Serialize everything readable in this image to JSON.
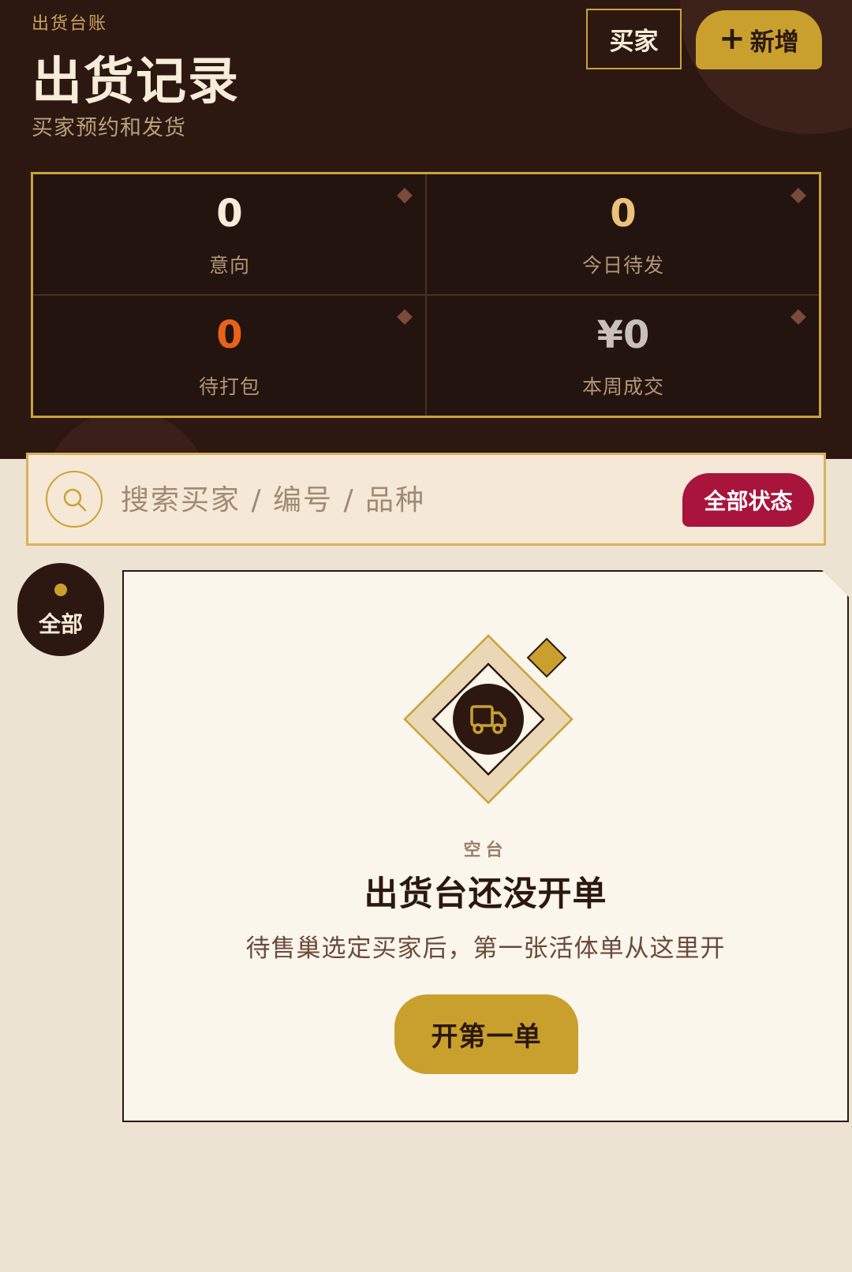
{
  "header": {
    "eyebrow": "出货台账",
    "title": "出货记录",
    "subtitle": "买家预约和发货",
    "buyer_button": "买家",
    "add_button": "新增",
    "add_icon": "plus-icon"
  },
  "stats": [
    {
      "value": "0",
      "label": "意向",
      "color": "#f7ecd8"
    },
    {
      "value": "0",
      "label": "今日待发",
      "color": "#ecc279"
    },
    {
      "value": "0",
      "label": "待打包",
      "color": "#e8621a"
    },
    {
      "value": "¥0",
      "label": "本周成交",
      "color": "#c9c1b7"
    }
  ],
  "search": {
    "placeholder": "搜索买家 / 编号 / 品种",
    "icon": "search-icon",
    "status_filter": "全部状态"
  },
  "tabs": [
    {
      "label": "全部",
      "active": true
    }
  ],
  "empty": {
    "icon": "truck-icon",
    "eyebrow": "空台",
    "title": "出货台还没开单",
    "description": "待售巢选定买家后，第一张活体单从这里开",
    "button": "开第一单"
  },
  "colors": {
    "header_bg": "#2c1811",
    "accent_gold": "#c9a02e",
    "filter_red": "#a8143c",
    "page_bg": "#ede3d2"
  }
}
